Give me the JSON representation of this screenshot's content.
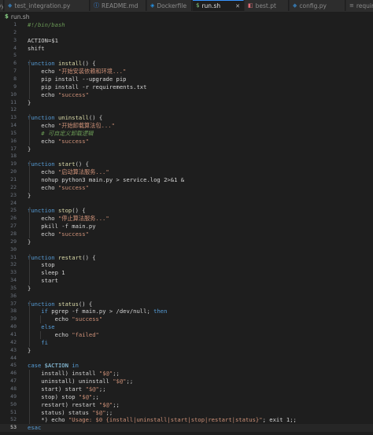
{
  "tabs": [
    {
      "label": "py",
      "icon": "python-file-icon",
      "icon_color": "#3572a5"
    },
    {
      "label": "test_integration.py",
      "icon": "python-file-icon",
      "icon_color": "#3572a5"
    },
    {
      "label": "README.md",
      "icon": "info-file-icon",
      "icon_color": "#3794ff"
    },
    {
      "label": "Dockerfile",
      "icon": "docker-file-icon",
      "icon_color": "#2496ed"
    },
    {
      "label": "run.sh",
      "icon": "shell-file-icon",
      "icon_color": "#89d185",
      "active": true
    },
    {
      "label": "best.pt",
      "icon": "binary-file-icon",
      "icon_color": "#e06c75"
    },
    {
      "label": "config.py",
      "icon": "python-file-icon",
      "icon_color": "#3572a5"
    },
    {
      "label": "requirem",
      "icon": "text-file-icon",
      "icon_color": "#8a8a8a"
    }
  ],
  "breadcrumb": {
    "icon": "$",
    "file": "run.sh"
  },
  "editor": {
    "current_line": 53,
    "lines": [
      [
        {
          "t": "#!/bin/bash",
          "c": "cmt"
        }
      ],
      [],
      [
        {
          "t": "ACTION=$1",
          "c": "plain"
        }
      ],
      [
        {
          "t": "shift",
          "c": "plain"
        }
      ],
      [],
      [
        {
          "t": "function ",
          "c": "kw"
        },
        {
          "t": "install",
          "c": "fn"
        },
        {
          "t": "() {",
          "c": "plain"
        }
      ],
      [
        {
          "t": "    echo ",
          "c": "plain"
        },
        {
          "t": "\"开始安装依赖和环境...\"",
          "c": "str"
        }
      ],
      [
        {
          "t": "    pip install --upgrade pip",
          "c": "plain"
        }
      ],
      [
        {
          "t": "    pip install -r requirements.txt",
          "c": "plain"
        }
      ],
      [
        {
          "t": "    echo ",
          "c": "plain"
        },
        {
          "t": "\"success\"",
          "c": "str"
        }
      ],
      [
        {
          "t": "}",
          "c": "plain"
        }
      ],
      [],
      [
        {
          "t": "function ",
          "c": "kw"
        },
        {
          "t": "uninstall",
          "c": "fn"
        },
        {
          "t": "() {",
          "c": "plain"
        }
      ],
      [
        {
          "t": "    echo ",
          "c": "plain"
        },
        {
          "t": "\"开始卸载算法包...\"",
          "c": "str"
        }
      ],
      [
        {
          "t": "    # 可自定义卸载逻辑",
          "c": "cmt"
        }
      ],
      [
        {
          "t": "    echo ",
          "c": "plain"
        },
        {
          "t": "\"success\"",
          "c": "str"
        }
      ],
      [
        {
          "t": "}",
          "c": "plain"
        }
      ],
      [],
      [
        {
          "t": "function ",
          "c": "kw"
        },
        {
          "t": "start",
          "c": "fn"
        },
        {
          "t": "() {",
          "c": "plain"
        }
      ],
      [
        {
          "t": "    echo ",
          "c": "plain"
        },
        {
          "t": "\"启动算法服务...\"",
          "c": "str"
        }
      ],
      [
        {
          "t": "    nohup python3 main.py > service.log 2>&1 &",
          "c": "plain"
        }
      ],
      [
        {
          "t": "    echo ",
          "c": "plain"
        },
        {
          "t": "\"success\"",
          "c": "str"
        }
      ],
      [
        {
          "t": "}",
          "c": "plain"
        }
      ],
      [],
      [
        {
          "t": "function ",
          "c": "kw"
        },
        {
          "t": "stop",
          "c": "fn"
        },
        {
          "t": "() {",
          "c": "plain"
        }
      ],
      [
        {
          "t": "    echo ",
          "c": "plain"
        },
        {
          "t": "\"停止算法服务...\"",
          "c": "str"
        }
      ],
      [
        {
          "t": "    pkill -f main.py",
          "c": "plain"
        }
      ],
      [
        {
          "t": "    echo ",
          "c": "plain"
        },
        {
          "t": "\"success\"",
          "c": "str"
        }
      ],
      [
        {
          "t": "}",
          "c": "plain"
        }
      ],
      [],
      [
        {
          "t": "function ",
          "c": "kw"
        },
        {
          "t": "restart",
          "c": "fn"
        },
        {
          "t": "() {",
          "c": "plain"
        }
      ],
      [
        {
          "t": "    stop",
          "c": "plain"
        }
      ],
      [
        {
          "t": "    sleep 1",
          "c": "plain"
        }
      ],
      [
        {
          "t": "    start",
          "c": "plain"
        }
      ],
      [
        {
          "t": "}",
          "c": "plain"
        }
      ],
      [],
      [
        {
          "t": "function ",
          "c": "kw"
        },
        {
          "t": "status",
          "c": "fn"
        },
        {
          "t": "() {",
          "c": "plain"
        }
      ],
      [
        {
          "t": "    if ",
          "c": "kw"
        },
        {
          "t": "pgrep -f main.py > /dev/null; ",
          "c": "plain"
        },
        {
          "t": "then",
          "c": "kw"
        }
      ],
      [
        {
          "t": "        echo ",
          "c": "plain"
        },
        {
          "t": "\"success\"",
          "c": "str"
        }
      ],
      [
        {
          "t": "    else",
          "c": "kw"
        }
      ],
      [
        {
          "t": "        echo ",
          "c": "plain"
        },
        {
          "t": "\"failed\"",
          "c": "str"
        }
      ],
      [
        {
          "t": "    fi",
          "c": "kw"
        }
      ],
      [
        {
          "t": "}",
          "c": "plain"
        }
      ],
      [],
      [
        {
          "t": "case ",
          "c": "kw"
        },
        {
          "t": "$ACTION",
          "c": "var"
        },
        {
          "t": " in",
          "c": "kw"
        }
      ],
      [
        {
          "t": "    install) install ",
          "c": "plain"
        },
        {
          "t": "\"$@\"",
          "c": "str"
        },
        {
          "t": ";;",
          "c": "plain"
        }
      ],
      [
        {
          "t": "    uninstall) uninstall ",
          "c": "plain"
        },
        {
          "t": "\"$@\"",
          "c": "str"
        },
        {
          "t": ";;",
          "c": "plain"
        }
      ],
      [
        {
          "t": "    start) start ",
          "c": "plain"
        },
        {
          "t": "\"$@\"",
          "c": "str"
        },
        {
          "t": ";;",
          "c": "plain"
        }
      ],
      [
        {
          "t": "    stop) stop ",
          "c": "plain"
        },
        {
          "t": "\"$@\"",
          "c": "str"
        },
        {
          "t": ";;",
          "c": "plain"
        }
      ],
      [
        {
          "t": "    restart) restart ",
          "c": "plain"
        },
        {
          "t": "\"$@\"",
          "c": "str"
        },
        {
          "t": ";;",
          "c": "plain"
        }
      ],
      [
        {
          "t": "    status) status ",
          "c": "plain"
        },
        {
          "t": "\"$@\"",
          "c": "str"
        },
        {
          "t": ";;",
          "c": "plain"
        }
      ],
      [
        {
          "t": "    *) echo ",
          "c": "plain"
        },
        {
          "t": "\"Usage: $0 {install|uninstall|start|stop|restart|status}\"",
          "c": "str"
        },
        {
          "t": "; exit 1;;",
          "c": "plain"
        }
      ],
      [
        {
          "t": "esac",
          "c": "kw"
        }
      ]
    ]
  }
}
